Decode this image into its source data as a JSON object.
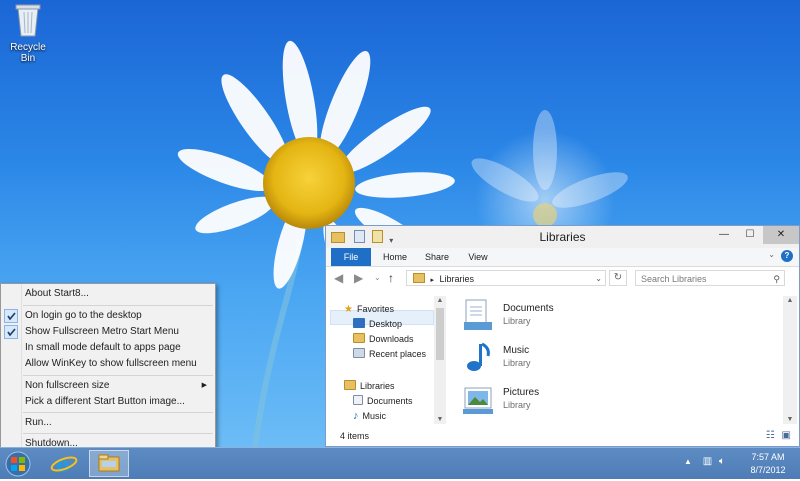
{
  "desktop": {
    "icons": [
      {
        "label": "Recycle Bin"
      }
    ]
  },
  "context_menu": {
    "items": [
      {
        "label": "About Start8...",
        "checked": false
      },
      {
        "label": "On login go to the desktop",
        "checked": true
      },
      {
        "label": "Show Fullscreen Metro Start Menu",
        "checked": true
      },
      {
        "label": "In small mode default to apps page",
        "checked": false
      },
      {
        "label": "Allow WinKey to show fullscreen menu",
        "checked": false
      },
      {
        "label": "Non fullscreen size",
        "checked": false,
        "submenu": true
      },
      {
        "label": "Pick a different Start Button image...",
        "checked": false
      },
      {
        "label": "Run...",
        "checked": false
      },
      {
        "label": "Shutdown...",
        "checked": false
      }
    ]
  },
  "explorer": {
    "title": "Libraries",
    "ribbon_tabs": [
      "File",
      "Home",
      "Share",
      "View"
    ],
    "address": "Libraries",
    "search_placeholder": "Search Libraries",
    "nav": {
      "favorites_label": "Favorites",
      "favorites": [
        "Desktop",
        "Downloads",
        "Recent places"
      ],
      "libraries_label": "Libraries",
      "libraries": [
        "Documents",
        "Music"
      ]
    },
    "items": [
      {
        "name": "Documents",
        "type": "Library"
      },
      {
        "name": "Music",
        "type": "Library"
      },
      {
        "name": "Pictures",
        "type": "Library"
      }
    ],
    "status": "4 items"
  },
  "taskbar": {
    "time": "7:57 AM",
    "date": "8/7/2012"
  }
}
